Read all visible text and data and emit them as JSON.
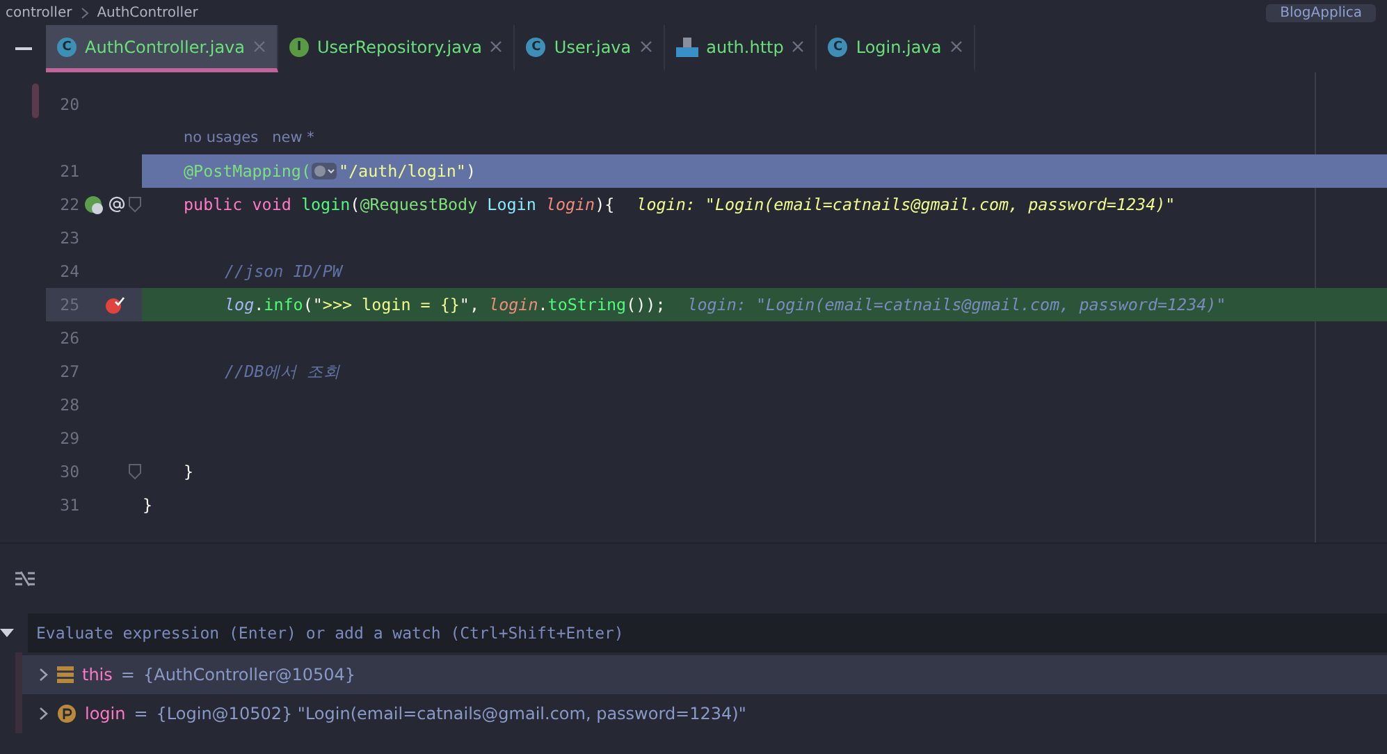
{
  "breadcrumb": [
    "controller",
    "AuthController"
  ],
  "run_config": {
    "label": "BlogApplica"
  },
  "tabs": [
    {
      "label": "AuthController.java",
      "kind": "class",
      "icon_letter": "C",
      "selected": true
    },
    {
      "label": "UserRepository.java",
      "kind": "interface",
      "icon_letter": "I",
      "selected": false
    },
    {
      "label": "User.java",
      "kind": "class",
      "icon_letter": "C",
      "selected": false
    },
    {
      "label": "auth.http",
      "kind": "http",
      "selected": false
    },
    {
      "label": "Login.java",
      "kind": "class",
      "icon_letter": "C",
      "selected": false
    }
  ],
  "code_lines": [
    {
      "number": "20"
    },
    {
      "kind": "inlay",
      "text": "no usages",
      "extra": "new *"
    },
    {
      "number": "21",
      "selected": true,
      "tokens": [
        {
          "kind": "annotation",
          "text": "@PostMapping("
        },
        {
          "kind": "globe"
        },
        {
          "kind": "string",
          "text": "\"/auth/login\""
        },
        {
          "kind": "plain",
          "text": ")"
        }
      ]
    },
    {
      "number": "22",
      "gutter_icons": [
        {
          "kind": "bean"
        },
        {
          "kind": "at"
        }
      ],
      "fold": true,
      "tokens": [
        {
          "kind": "keyword",
          "text": "public "
        },
        {
          "kind": "keyword",
          "text": "void "
        },
        {
          "kind": "method",
          "text": "login"
        },
        {
          "kind": "plain",
          "text": "("
        },
        {
          "kind": "annotation",
          "text": "@RequestBody "
        },
        {
          "kind": "type",
          "text": "Login "
        },
        {
          "kind": "param",
          "text": "login"
        },
        {
          "kind": "plain",
          "text": "){"
        }
      ],
      "hint": "login: \"Login(email=catnails@gmail.com, password=1234)\""
    },
    {
      "number": "23"
    },
    {
      "number": "24",
      "tokens": [
        {
          "kind": "comment",
          "text": "//json ID/PW"
        }
      ]
    },
    {
      "number": "25",
      "execution_point": true,
      "gutter_icons": [
        {
          "kind": "breakpoint"
        }
      ],
      "tokens": [
        {
          "kind": "field",
          "text": "log"
        },
        {
          "kind": "plain",
          "text": "."
        },
        {
          "kind": "method",
          "text": "info"
        },
        {
          "kind": "plain",
          "text": "(\""
        },
        {
          "kind": "string",
          "text": ">>> login = {}"
        },
        {
          "kind": "plain",
          "text": "\", "
        },
        {
          "kind": "param",
          "text": "login"
        },
        {
          "kind": "plain",
          "text": "."
        },
        {
          "kind": "method",
          "text": "toString"
        },
        {
          "kind": "plain",
          "text": "());"
        }
      ],
      "hint": "login: \"Login(email=catnails@gmail.com, password=1234)\""
    },
    {
      "number": "26"
    },
    {
      "number": "27",
      "tokens": [
        {
          "kind": "comment",
          "text": "//DB에서 조회"
        }
      ]
    },
    {
      "number": "28"
    },
    {
      "number": "29"
    },
    {
      "number": "30",
      "fold": true,
      "tokens": [
        {
          "kind": "plain",
          "text": "}"
        }
      ]
    },
    {
      "number": "31",
      "tokens": [
        {
          "kind": "plain",
          "text": "}"
        }
      ]
    }
  ],
  "debugger": {
    "watch_placeholder": "Evaluate expression (Enter) or add a watch (Ctrl+Shift+Enter)",
    "variables": [
      {
        "kind": "field",
        "name": "this",
        "operator": "=",
        "value": "{AuthController@10504}",
        "selected": true
      },
      {
        "kind": "param",
        "name": "login",
        "operator": "=",
        "value": "{Login@10502} \"Login(email=catnails@gmail.com, password=1234)\"",
        "selected": false
      }
    ]
  }
}
